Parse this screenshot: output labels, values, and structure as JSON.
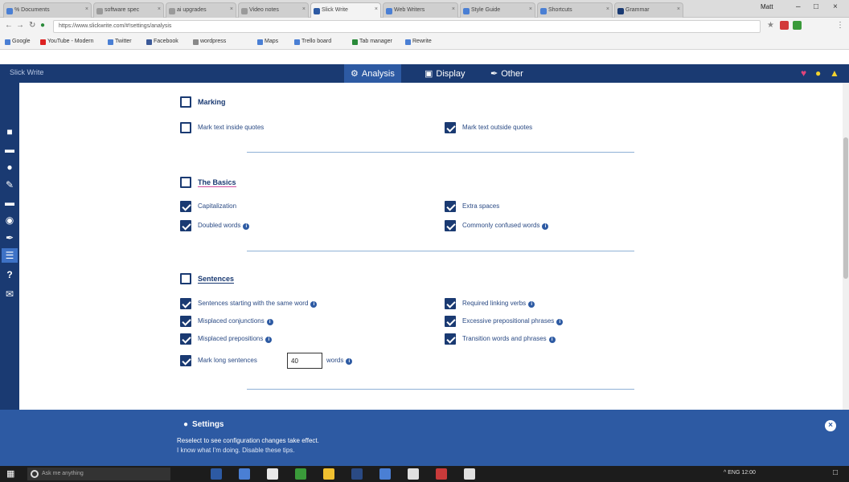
{
  "browser": {
    "tabs": [
      {
        "label": "% Documents",
        "active": false,
        "color": "#4a7fd4"
      },
      {
        "label": "software spec",
        "active": false,
        "color": "#9a9a9a"
      },
      {
        "label": "ai upgrades",
        "active": false,
        "color": "#9a9a9a"
      },
      {
        "label": "Video notes",
        "active": false,
        "color": "#9a9a9a"
      },
      {
        "label": "Slick Write",
        "active": true,
        "color": "#2d5aa3"
      },
      {
        "label": "Web Writers",
        "active": false,
        "color": "#4a7fd4"
      },
      {
        "label": "Style Guide",
        "active": false,
        "color": "#4a7fd4"
      },
      {
        "label": "Shortcuts",
        "active": false,
        "color": "#4a7fd4"
      },
      {
        "label": "Grammar",
        "active": false,
        "color": "#1a3a72"
      }
    ],
    "user": "Matt",
    "address": "https://www.slickwrite.com/#!settings/analysis",
    "bookmarks": [
      {
        "label": "Google",
        "color": "#4a7fd4"
      },
      {
        "label": "YouTube - Modern",
        "color": "#d22"
      },
      {
        "label": "Twitter",
        "color": "#4a7fd4"
      },
      {
        "label": "Facebook",
        "color": "#3b5998"
      },
      {
        "label": "wordpress",
        "color": "#888"
      },
      {
        "label": "Maps",
        "color": "#4a7fd4"
      },
      {
        "label": "Trello board",
        "color": "#4a7fd4"
      },
      {
        "label": "Tab manager",
        "color": "#2a8a3a"
      },
      {
        "label": "Rewrite",
        "color": "#4a7fd4"
      }
    ]
  },
  "app": {
    "brand": "Slick Write",
    "nav": [
      {
        "label": "Analysis",
        "icon": "cogs-icon",
        "active": true
      },
      {
        "label": "Display",
        "icon": "monitor-icon",
        "active": false
      },
      {
        "label": "Other",
        "icon": "wrench-icon",
        "active": false
      }
    ],
    "header_icons": [
      {
        "name": "heart-icon",
        "color": "#e0457b"
      },
      {
        "name": "lightbulb-icon",
        "color": "#f2d22e"
      },
      {
        "name": "warning-icon",
        "color": "#f2d22e"
      }
    ],
    "sidebar_icons": [
      "save-icon",
      "folder-icon",
      "cloud-icon",
      "pencil-icon",
      "folder-open-icon",
      "bug-icon",
      "brush-icon",
      "sliders-icon",
      "help-icon",
      "envelope-icon"
    ],
    "sidebar_active": 7
  },
  "sections": {
    "marking": {
      "title": "Marking",
      "options": [
        {
          "label": "Mark text inside quotes",
          "checked": false,
          "info": false
        },
        {
          "label": "Mark text outside quotes",
          "checked": true,
          "info": false
        }
      ]
    },
    "basics": {
      "title": "The Basics",
      "options": [
        {
          "label": "Capitalization",
          "checked": true,
          "info": false
        },
        {
          "label": "Extra spaces",
          "checked": true,
          "info": false
        },
        {
          "label": "Doubled words",
          "checked": true,
          "info": true
        },
        {
          "label": "Commonly confused words",
          "checked": true,
          "info": true
        }
      ]
    },
    "sentences": {
      "title": "Sentences",
      "options": [
        {
          "label": "Sentences starting with the same word",
          "checked": true,
          "info": true
        },
        {
          "label": "Required linking verbs",
          "checked": true,
          "info": true
        },
        {
          "label": "Misplaced conjunctions",
          "checked": true,
          "info": true
        },
        {
          "label": "Excessive prepositional phrases",
          "checked": true,
          "info": true
        },
        {
          "label": "Misplaced prepositions",
          "checked": true,
          "info": true
        },
        {
          "label": "Transition words and phrases",
          "checked": true,
          "info": true
        }
      ],
      "long_sentence": {
        "label": "Mark long sentences",
        "value": "40",
        "suffix": "words",
        "checked": true
      }
    }
  },
  "banner": {
    "title": "Settings",
    "line1": "Reselect to see configuration changes take effect.",
    "line2": "I know what I'm doing. Disable these tips."
  },
  "taskbar": {
    "search": "Ask me anything",
    "apps": [
      "#2d5aa3",
      "#4a7fd4",
      "#e8e8e8",
      "#3a9a3a",
      "#f0c030",
      "#2a4a84",
      "#4a7fd4",
      "#e0e0e0",
      "#c83a3a",
      "#e0e0e0"
    ],
    "tray": "^ ENG  12:00"
  }
}
